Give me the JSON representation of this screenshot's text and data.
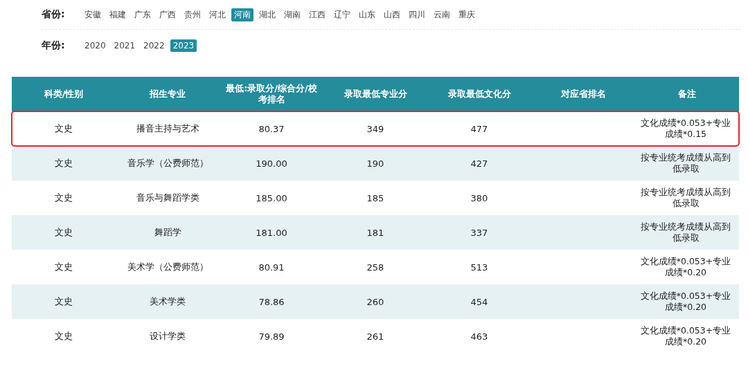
{
  "filters": [
    {
      "label": "省份:",
      "options": [
        {
          "text": "安徽",
          "selected": false
        },
        {
          "text": "福建",
          "selected": false
        },
        {
          "text": "广东",
          "selected": false
        },
        {
          "text": "广西",
          "selected": false
        },
        {
          "text": "贵州",
          "selected": false
        },
        {
          "text": "河北",
          "selected": false
        },
        {
          "text": "河南",
          "selected": true
        },
        {
          "text": "湖北",
          "selected": false
        },
        {
          "text": "湖南",
          "selected": false
        },
        {
          "text": "江西",
          "selected": false
        },
        {
          "text": "辽宁",
          "selected": false
        },
        {
          "text": "山东",
          "selected": false
        },
        {
          "text": "山西",
          "selected": false
        },
        {
          "text": "四川",
          "selected": false
        },
        {
          "text": "云南",
          "selected": false
        },
        {
          "text": "重庆",
          "selected": false
        }
      ]
    },
    {
      "label": "年份:",
      "options": [
        {
          "text": "2020",
          "selected": false
        },
        {
          "text": "2021",
          "selected": false
        },
        {
          "text": "2022",
          "selected": false
        },
        {
          "text": "2023",
          "selected": true
        }
      ]
    }
  ],
  "table": {
    "columns": [
      "科类/性别",
      "招生专业",
      "最低:录取分/综合分/校考排名",
      "录取最低专业分",
      "录取最低文化分",
      "对应省排名",
      "备注"
    ],
    "rows": [
      {
        "cells": [
          "文史",
          "播音主持与艺术",
          "80.37",
          "349",
          "477",
          "",
          "文化成绩*0.053+专业成绩*0.15"
        ],
        "highlighted": true
      },
      {
        "cells": [
          "文史",
          "音乐学（公费师范）",
          "190.00",
          "190",
          "427",
          "",
          "按专业统考成绩从高到低录取"
        ],
        "highlighted": false
      },
      {
        "cells": [
          "文史",
          "音乐与舞蹈学类",
          "185.00",
          "185",
          "380",
          "",
          "按专业统考成绩从高到低录取"
        ],
        "highlighted": false
      },
      {
        "cells": [
          "文史",
          "舞蹈学",
          "181.00",
          "181",
          "337",
          "",
          "按专业统考成绩从高到低录取"
        ],
        "highlighted": false
      },
      {
        "cells": [
          "文史",
          "美术学（公费师范）",
          "80.91",
          "258",
          "513",
          "",
          "文化成绩*0.053+专业成绩*0.20"
        ],
        "highlighted": false
      },
      {
        "cells": [
          "文史",
          "美术学类",
          "78.86",
          "260",
          "454",
          "",
          "文化成绩*0.053+专业成绩*0.20"
        ],
        "highlighted": false
      },
      {
        "cells": [
          "文史",
          "设计学类",
          "79.89",
          "261",
          "463",
          "",
          "文化成绩*0.053+专业成绩*0.20"
        ],
        "highlighted": false
      }
    ]
  }
}
